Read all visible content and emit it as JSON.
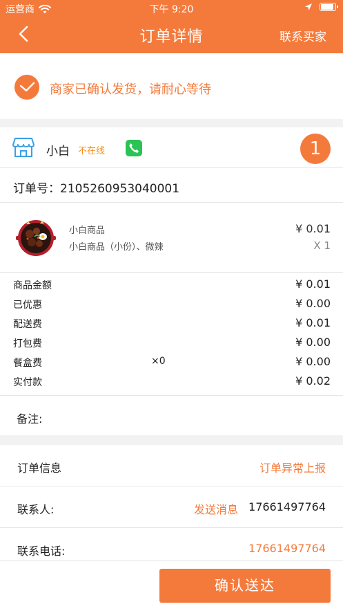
{
  "status_bar": {
    "carrier": "运营商",
    "time": "下午 9:20"
  },
  "nav": {
    "title": "订单详情",
    "right_action": "联系买家"
  },
  "notice": {
    "text": "商家已确认发货，请耐心等待"
  },
  "shop": {
    "name": "小白",
    "status": "不在线",
    "badge_number": "1"
  },
  "order": {
    "number_label": "订单号：2105260953040001"
  },
  "product": {
    "name": "小白商品",
    "spec": "小白商品（小份）、微辣",
    "price": "¥ 0.01",
    "quantity": "X 1"
  },
  "fees": [
    {
      "label": "商品金额",
      "extra": "",
      "value": "¥ 0.01"
    },
    {
      "label": "已优惠",
      "extra": "",
      "value": "¥ 0.00"
    },
    {
      "label": "配送费",
      "extra": "",
      "value": "¥ 0.01"
    },
    {
      "label": "打包费",
      "extra": "",
      "value": "¥ 0.00"
    },
    {
      "label": "餐盒费",
      "extra": "×0",
      "value": "¥ 0.00"
    },
    {
      "label": "实付款",
      "extra": "",
      "value": "¥ 0.02"
    }
  ],
  "remark": {
    "label": "备注:"
  },
  "info": {
    "order_info_label": "订单信息",
    "report_link": "订单异常上报",
    "contact_label": "联系人:",
    "send_message_link": "发送消息",
    "contact_phone": "17661497764",
    "phone_label": "联系电话:",
    "phone_link": "17661497764"
  },
  "bottom": {
    "confirm_button": "确认送达"
  },
  "colors": {
    "accent": "#f47a3c",
    "offline_status": "#f0901e",
    "phone_green": "#2bc256"
  }
}
